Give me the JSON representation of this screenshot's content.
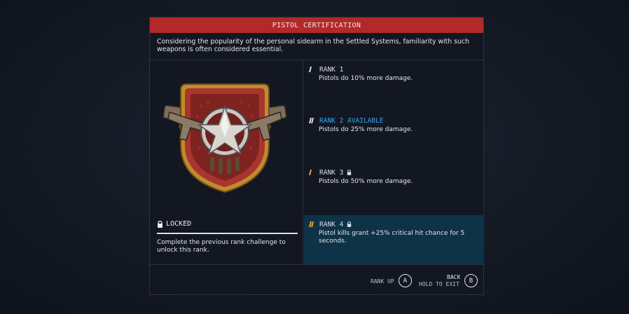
{
  "panel": {
    "title": "PISTOL CERTIFICATION",
    "description": "Considering the popularity of the personal sidearm in the Settled Systems, familiarity with such weapons is often considered essential."
  },
  "status": {
    "label": "LOCKED",
    "description": "Complete the previous rank challenge to unlock this rank."
  },
  "ranks": [
    {
      "title": "RANK 1",
      "description": "Pistols do 10% more damage.",
      "locked": false,
      "available": false,
      "selected": false
    },
    {
      "title": "RANK 2 AVAILABLE",
      "description": "Pistols do 25% more damage.",
      "locked": false,
      "available": true,
      "selected": false
    },
    {
      "title": "RANK 3",
      "description": "Pistols do 50% more damage.",
      "locked": true,
      "available": false,
      "selected": false
    },
    {
      "title": "RANK 4",
      "description": "Pistol kills grant +25% critical hit chance for 5 seconds.",
      "locked": true,
      "available": false,
      "selected": true
    }
  ],
  "footer": {
    "rank_up_label": "RANK UP",
    "rank_up_key": "A",
    "back_label": "BACK",
    "hold_exit_label": "HOLD TO EXIT",
    "back_key": "B"
  },
  "colors": {
    "title_bar": "#b3282b",
    "available_text": "#3aa7e6",
    "selected_row": "#0f3346",
    "rank_bar_white": "#d8dde6",
    "rank_bar_orange": "#e8a22c"
  },
  "icons": [
    "lock-icon",
    "skill-badge-icon",
    "rank-bars-icon"
  ]
}
